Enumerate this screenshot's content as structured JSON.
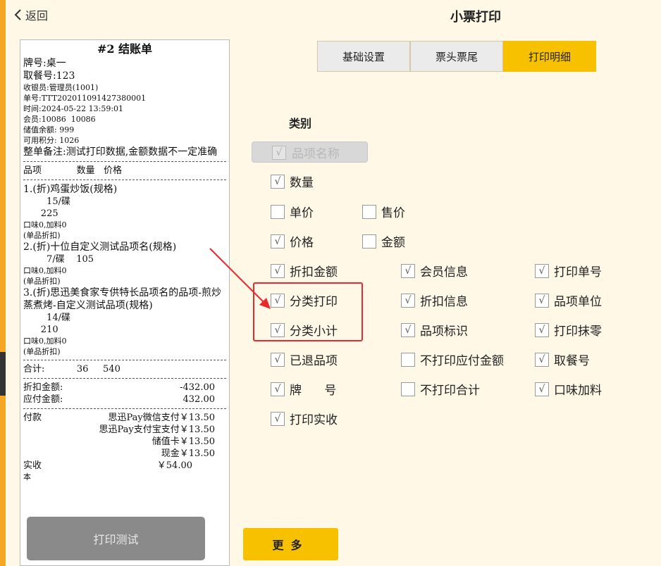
{
  "header": {
    "back_label": "返回",
    "title": "小票打印"
  },
  "receipt": {
    "title": "#2 结账单",
    "plate": "牌号:桌一",
    "pickup": "取餐号:123",
    "cashier": "收银员:管理员(1001)",
    "order_no": "单号:TTT202011091427380001",
    "time": "时间:2024-05-22 13:59:01",
    "member": "会员:10086  10086",
    "balance": "储值余额: 999",
    "points": "可用积分: 1026",
    "note": "整单备注:测试打印数据,金额数据不一定准确",
    "dash": "-----------------------------------------------------",
    "header_row": "品项            数量   价格",
    "items": [
      {
        "name": "1.(折)鸡蛋炒饭(规格)",
        "qty": "        15/碟",
        "price": "      225",
        "flavor": "口味0,加料0",
        "discount": "(单品折扣)"
      },
      {
        "name": "2.(折)十位自定义测试品项名(规格)",
        "qty": "        7/碟    105",
        "flavor": "口味0,加料0",
        "discount": "(单品折扣)"
      },
      {
        "name": "3.(折)思迅美食家专供特长品项名的品项-煎炒蒸煮烤-自定义测试品项(规格)",
        "qty": "        14/碟",
        "price": "      210",
        "flavor": "口味0,加料0",
        "discount": "(单品折扣)"
      }
    ],
    "total_row": "合计:           36     540",
    "discount_label": "折扣金额:",
    "discount_value": "-432.00",
    "payable_label": "应付金额:",
    "payable_value": "432.00",
    "pay_label": "付款",
    "payments": [
      "思迅Pay微信支付￥13.50",
      "思迅Pay支付宝支付￥13.50",
      "储值卡￥13.50",
      "现金￥13.50"
    ],
    "received_label": "实收",
    "received_value": "￥54.00",
    "truncated_line": "本"
  },
  "print_test_label": "打印测试",
  "tabs": [
    {
      "label": "基础设置",
      "active": false
    },
    {
      "label": "票头票尾",
      "active": false
    },
    {
      "label": "打印明细",
      "active": true
    }
  ],
  "category_label": "类别",
  "options": {
    "item_name": {
      "label": "品项名称",
      "checked": true,
      "disabled": true
    },
    "quantity": {
      "label": "数量",
      "checked": true
    },
    "unit_price": {
      "label": "单价",
      "checked": false
    },
    "sale_price": {
      "label": "售价",
      "checked": false
    },
    "price": {
      "label": "价格",
      "checked": true
    },
    "amount": {
      "label": "金额",
      "checked": false
    },
    "discount_amount": {
      "label": "折扣金额",
      "checked": true
    },
    "member_info": {
      "label": "会员信息",
      "checked": true
    },
    "print_order_no": {
      "label": "打印单号",
      "checked": true
    },
    "category_print": {
      "label": "分类打印",
      "checked": true
    },
    "discount_info": {
      "label": "折扣信息",
      "checked": true
    },
    "item_unit": {
      "label": "品项单位",
      "checked": true
    },
    "category_subtotal": {
      "label": "分类小计",
      "checked": true
    },
    "item_mark": {
      "label": "品项标识",
      "checked": true
    },
    "print_rounding": {
      "label": "打印抹零",
      "checked": true
    },
    "returned_items": {
      "label": "已退品项",
      "checked": true
    },
    "no_print_payable": {
      "label": "不打印应付金额",
      "checked": false
    },
    "pickup_no": {
      "label": "取餐号",
      "checked": true
    },
    "plate_no": {
      "label": "牌      号",
      "checked": true
    },
    "no_print_total": {
      "label": "不打印合计",
      "checked": false
    },
    "flavor_addon": {
      "label": "口味加料",
      "checked": true
    },
    "print_received": {
      "label": "打印实收",
      "checked": true
    }
  },
  "check_mark": "√",
  "more_label": "更多"
}
